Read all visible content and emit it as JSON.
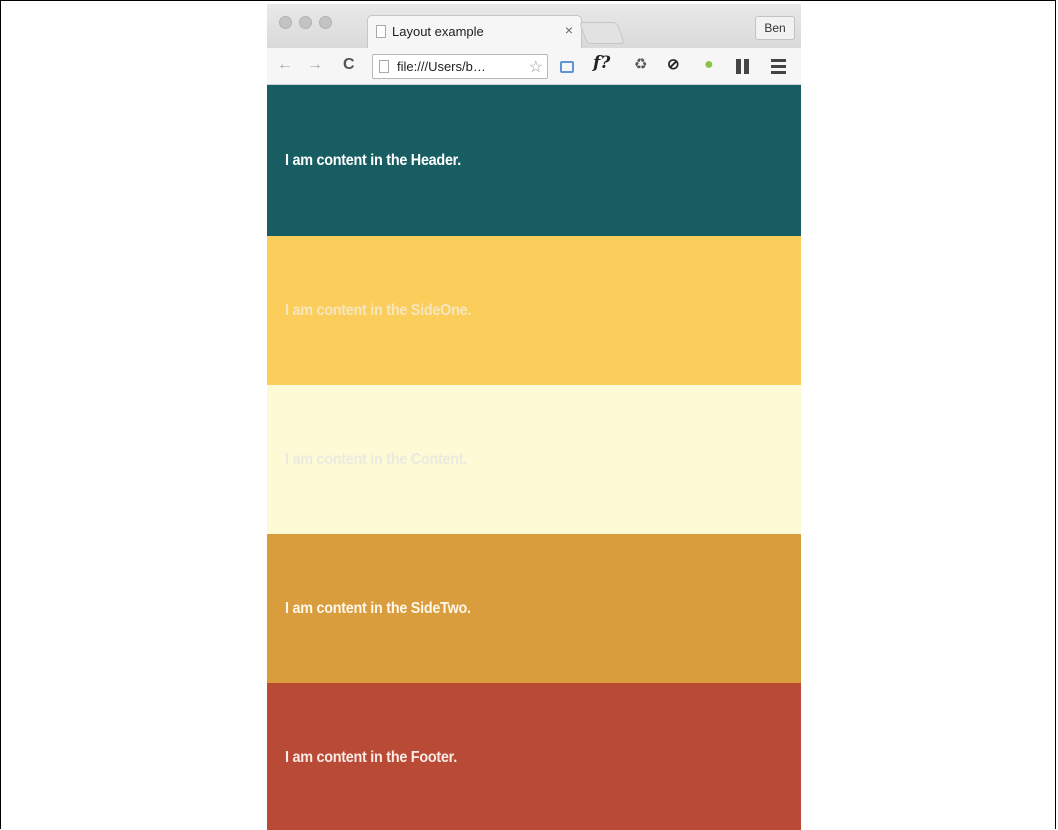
{
  "browser": {
    "tab_title": "Layout example",
    "tab_close": "×",
    "profile_name": "Ben",
    "url": "file:///Users/b…",
    "icons": [
      "back-icon",
      "forward-icon",
      "reload-icon",
      "page-icon",
      "star-icon",
      "cast-icon",
      "f-question-icon",
      "recycle-icon",
      "circle-icon",
      "android-icon",
      "columns-icon",
      "menu-icon"
    ]
  },
  "glyphs": {
    "back": "←",
    "forward": "→",
    "reload": "C",
    "star": "☆",
    "f": "f?",
    "recycle": "♻",
    "circle": "⊘",
    "android": "●"
  },
  "sections": {
    "header": "I am content in the Header.",
    "sideone": "I am content in the SideOne.",
    "content": "I am content in the Content.",
    "sidetwo": "I am content in the SideTwo.",
    "footer": "I am content in the Footer."
  },
  "colors": {
    "header": "#175d62",
    "sideone": "#fbcd5b",
    "content": "#fdfad6",
    "sidetwo": "#d99d3e",
    "footer": "#b94a36"
  }
}
